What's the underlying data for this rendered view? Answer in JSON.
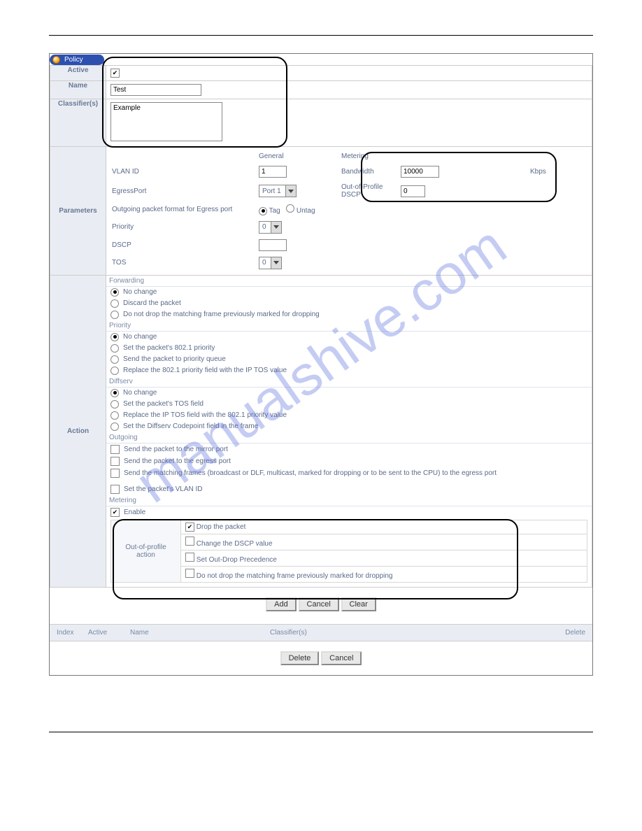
{
  "watermark": "manualshive.com",
  "tab_title": "Policy",
  "labels": {
    "active": "Active",
    "name": "Name",
    "classifiers": "Classifier(s)",
    "parameters": "Parameters",
    "action": "Action"
  },
  "form": {
    "active_checked": true,
    "name_value": "Test",
    "classifier_value": "Example"
  },
  "parameters": {
    "general_header": "General",
    "metering_header": "Metering",
    "vlan_id_label": "VLAN ID",
    "vlan_id_value": "1",
    "egress_port_label": "EgressPort",
    "egress_port_value": "Port 1",
    "outgoing_format_label": "Outgoing packet format for Egress port",
    "tag_label": "Tag",
    "untag_label": "Untag",
    "priority_label": "Priority",
    "priority_value": "0",
    "dscp_label": "DSCP",
    "dscp_value": "",
    "tos_label": "TOS",
    "tos_value": "0",
    "bandwidth_label": "Bandwidth",
    "bandwidth_value": "10000",
    "bandwidth_unit": "Kbps",
    "oop_dscp_label": "Out-of-Profile DSCP",
    "oop_dscp_value": "0"
  },
  "action": {
    "forwarding": {
      "header": "Forwarding",
      "options": [
        {
          "label": "No change",
          "checked": true
        },
        {
          "label": "Discard the packet",
          "checked": false
        },
        {
          "label": "Do not drop the matching frame previously marked for dropping",
          "checked": false
        }
      ]
    },
    "priority": {
      "header": "Priority",
      "options": [
        {
          "label": "No change",
          "checked": true
        },
        {
          "label": "Set the packet's 802.1 priority",
          "checked": false
        },
        {
          "label": "Send the packet to priority queue",
          "checked": false
        },
        {
          "label": "Replace the 802.1 priority field with the IP TOS value",
          "checked": false
        }
      ]
    },
    "diffserv": {
      "header": "Diffserv",
      "options": [
        {
          "label": "No change",
          "checked": true
        },
        {
          "label": "Set the packet's TOS field",
          "checked": false
        },
        {
          "label": "Replace the IP TOS field with the 802.1 priority value",
          "checked": false
        },
        {
          "label": "Set the Diffserv Codepoint field in the frame",
          "checked": false
        }
      ]
    },
    "outgoing": {
      "header": "Outgoing",
      "options": [
        {
          "label": "Send the packet to the mirror port",
          "checked": false
        },
        {
          "label": "Send the packet to the egress port",
          "checked": false
        },
        {
          "label": "Send the matching frames (broadcast or DLF, multicast, marked for dropping or to be sent to the CPU) to the egress port",
          "checked": false
        },
        {
          "label": "Set the packet's VLAN ID",
          "checked": false
        }
      ]
    },
    "metering": {
      "header": "Metering",
      "enable_label": "Enable",
      "enable_checked": true,
      "oop_action_label": "Out-of-profile action",
      "options": [
        {
          "label": "Drop the packet",
          "checked": true
        },
        {
          "label": "Change the DSCP value",
          "checked": false
        },
        {
          "label": "Set Out-Drop Precedence",
          "checked": false
        },
        {
          "label": "Do not drop the matching frame previously marked for dropping",
          "checked": false
        }
      ]
    }
  },
  "buttons": {
    "add": "Add",
    "cancel": "Cancel",
    "clear": "Clear",
    "delete": "Delete"
  },
  "list_headers": {
    "index": "Index",
    "active": "Active",
    "name": "Name",
    "classifiers": "Classifier(s)",
    "delete": "Delete"
  }
}
